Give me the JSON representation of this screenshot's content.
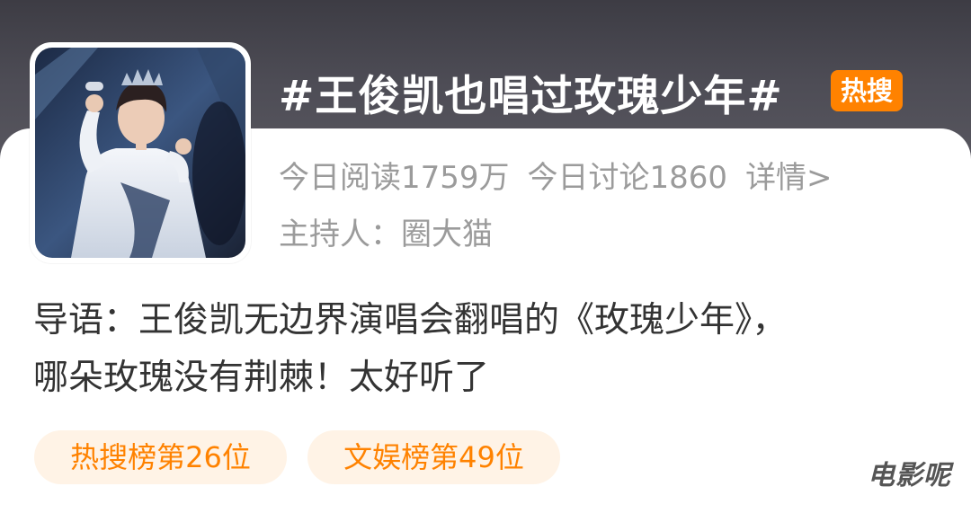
{
  "topic": {
    "title": "#王俊凯也唱过玫瑰少年#",
    "badge": "热搜",
    "badge_color": "#ff8200"
  },
  "stats": {
    "reads": "今日阅读1759万",
    "discussions": "今日讨论1860",
    "detail_link": "详情>"
  },
  "host": "主持人：圈大猫",
  "intro": {
    "line1": "导语：王俊凯无边界演唱会翻唱的《玫瑰少年》，",
    "line2": "哪朵玫瑰没有荆棘！太好听了"
  },
  "tags": [
    {
      "label": "热搜榜第26位"
    },
    {
      "label": "文娱榜第49位"
    }
  ],
  "watermark": "电影呢",
  "avatar": {
    "description_icon": "topic-cover-photo"
  }
}
